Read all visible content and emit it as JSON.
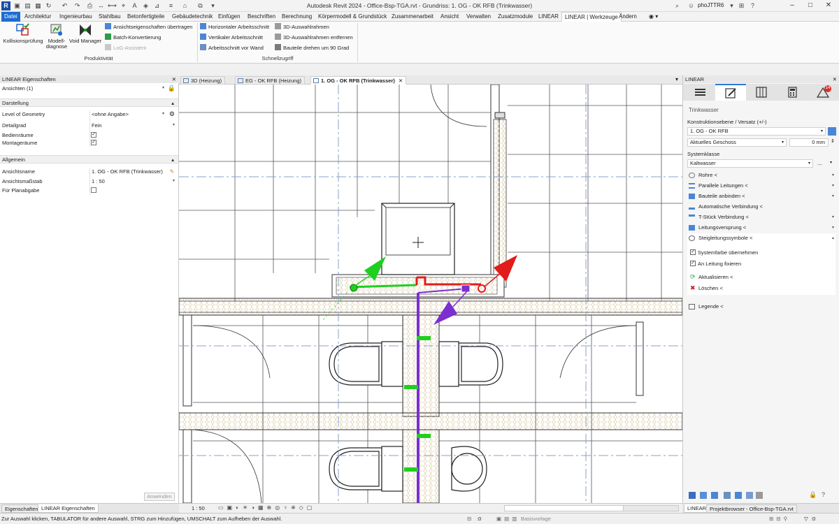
{
  "titlebar": {
    "title": "Autodesk Revit 2024 - Office-Bsp-TGA.rvt - Grundriss: 1. OG - OK RFB (Trinkwasser)",
    "user": "phoJTTR6"
  },
  "ribbon_tabs": [
    "Datei",
    "Architektur",
    "Ingenieurbau",
    "Stahlbau",
    "Betonfertigteile",
    "Gebäudetechnik",
    "Einfügen",
    "Beschriften",
    "Berechnung",
    "Körpermodell & Grundstück",
    "Zusammenarbeit",
    "Ansicht",
    "Verwalten",
    "Zusatzmodule",
    "LINEAR",
    "LINEAR | Werkzeuge",
    "Ändern"
  ],
  "ribbon": {
    "kollision": "Kollisionsprüfung",
    "modell_1": "Modell-",
    "modell_2": "diagnose",
    "void": "Void Manager",
    "ansichtseig": "Ansichtseigenschaften übertragen",
    "batch": "Batch-Konvertierung",
    "log": "LoG-Assistent",
    "panel_produktivitaet": "Produktivität",
    "horiz": "Horizontaler Arbeitsschnitt",
    "vert": "Vertikaler Arbeitsschnitt",
    "arbwand": "Arbeitsschnitt vor Wand",
    "auswahl3d": "3D-Auswahlrahmen",
    "auswahl3d_entf": "3D-Auswahlrahmen entfernen",
    "drehen": "Bauteile drehen um 90 Grad",
    "panel_schnellzugriff": "Schnellzugriff"
  },
  "left_panel": {
    "title": "LINEAR Eigenschaften",
    "selector": "Ansichten (1)",
    "cat_darstellung": "Darstellung",
    "log_k": "Level of Geometry",
    "log_v": "<ohne Angabe>",
    "detail_k": "Detailgrad",
    "detail_v": "Fein",
    "bedien_k": "Bedienräume",
    "montage_k": "Montageräume",
    "cat_allgemein": "Allgemein",
    "name_k": "Ansichtsname",
    "name_v": "1. OG - OK RFB (Trinkwasser)",
    "massstab_k": "Ansichtsmaßstab",
    "massstab_v": "1 : 50",
    "plan_k": "Für Planabgabe",
    "apply": "Anwenden"
  },
  "view_tabs": [
    "3D (Heizung)",
    "EG - OK RFB (Heizung)",
    "1. OG - OK RFB (Trinkwasser)"
  ],
  "right_panel": {
    "title": "LINEAR",
    "badge": "14",
    "heading": "Trinkwasser",
    "konstr_label": "Konstruktionsebene / Versatz (+/-)",
    "konstr_value": "1. OG - OK RFB",
    "geschoss": "Aktuelles Geschoss",
    "offset": "0 mm",
    "system_label": "Systemklasse",
    "system_value": "Kaltwasser",
    "dots": "...",
    "items": [
      "Rohre <",
      "Parallele Leitungen <",
      "Bauteile anbinden <",
      "Automatische Verbindung <",
      "T-Stück Verbindung <",
      "Leitungsversprung <",
      "Steigleitungssymbole <"
    ],
    "cb_systemfarbe": "Systemfarbe übernehmen",
    "cb_fixieren": "An Leitung fixieren",
    "aktualisieren": "Aktualisieren <",
    "loeschen": "Löschen <",
    "legende": "Legende <"
  },
  "bottom_left_tabs": [
    "Eigenschaften",
    "LINEAR Eigenschaften"
  ],
  "bottom_right_tabs": [
    "LINEAR",
    "Projektbrowser - Office-Bsp-TGA.rvt"
  ],
  "viewbar": {
    "scale": "1 : 50"
  },
  "statusbar": {
    "hint": "Zur Auswahl klicken, TABULATOR für andere Auswahl, STRG zum Hinzufügen, UMSCHALT zum Aufheben der Auswahl.",
    "zero1": ":0",
    "workset": "Basisvorlage",
    "zero2": ":0"
  },
  "colors": {
    "accent": "#1d6bd0",
    "pipe_red": "#e21b1b",
    "pipe_green": "#1fcf1f",
    "pipe_purple": "#7b2fd0"
  }
}
